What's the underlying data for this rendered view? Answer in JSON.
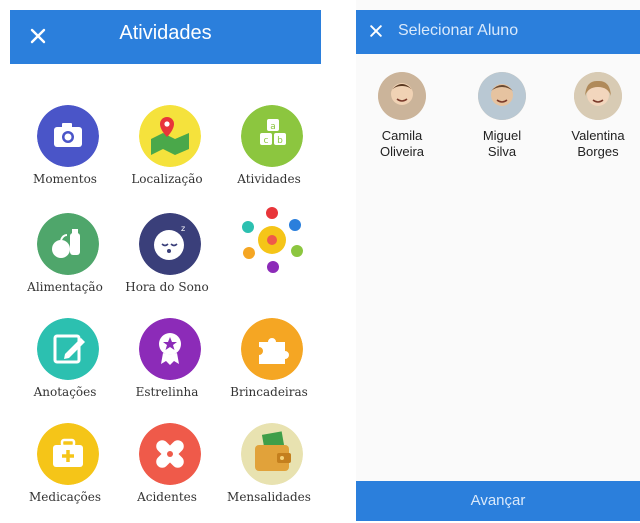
{
  "activities_screen": {
    "title": "Atividades",
    "close_icon": "close-icon",
    "accent": "#2b7fdc",
    "tiles": [
      {
        "label": "Momentos",
        "icon": "camera-icon",
        "color": "#4a55c8"
      },
      {
        "label": "Localização",
        "icon": "map-pin-icon",
        "color": "#f5e23c"
      },
      {
        "label": "Atividades",
        "icon": "abc-blocks-icon",
        "color": "#8cc63f"
      },
      {
        "label": "Alimentação",
        "icon": "food-icon",
        "color": "#4fa66b"
      },
      {
        "label": "Hora do Sono",
        "icon": "sleeping-baby-icon",
        "color": "#3a3f7a"
      },
      {
        "label": "",
        "icon": "children-circle-icon",
        "color": "#ffffff"
      },
      {
        "label": "Anotações",
        "icon": "edit-note-icon",
        "color": "#2cc0b0"
      },
      {
        "label": "Estrelinha",
        "icon": "star-badge-icon",
        "color": "#8c2bb8"
      },
      {
        "label": "Brincadeiras",
        "icon": "puzzle-icon",
        "color": "#f5a623"
      },
      {
        "label": "Medicações",
        "icon": "medical-kit-icon",
        "color": "#f5c518"
      },
      {
        "label": "Acidentes",
        "icon": "bandage-icon",
        "color": "#ef5a4a"
      },
      {
        "label": "Mensalidades",
        "icon": "wallet-money-icon",
        "color": "#e8e2b0"
      }
    ]
  },
  "select_student_screen": {
    "title": "Selecionar Aluno",
    "close_icon": "close-icon",
    "students": [
      {
        "first": "Camila",
        "last": "Oliveira"
      },
      {
        "first": "Miguel",
        "last": "Silva"
      },
      {
        "first": "Valentina",
        "last": "Borges"
      }
    ],
    "next_label": "Avançar"
  }
}
